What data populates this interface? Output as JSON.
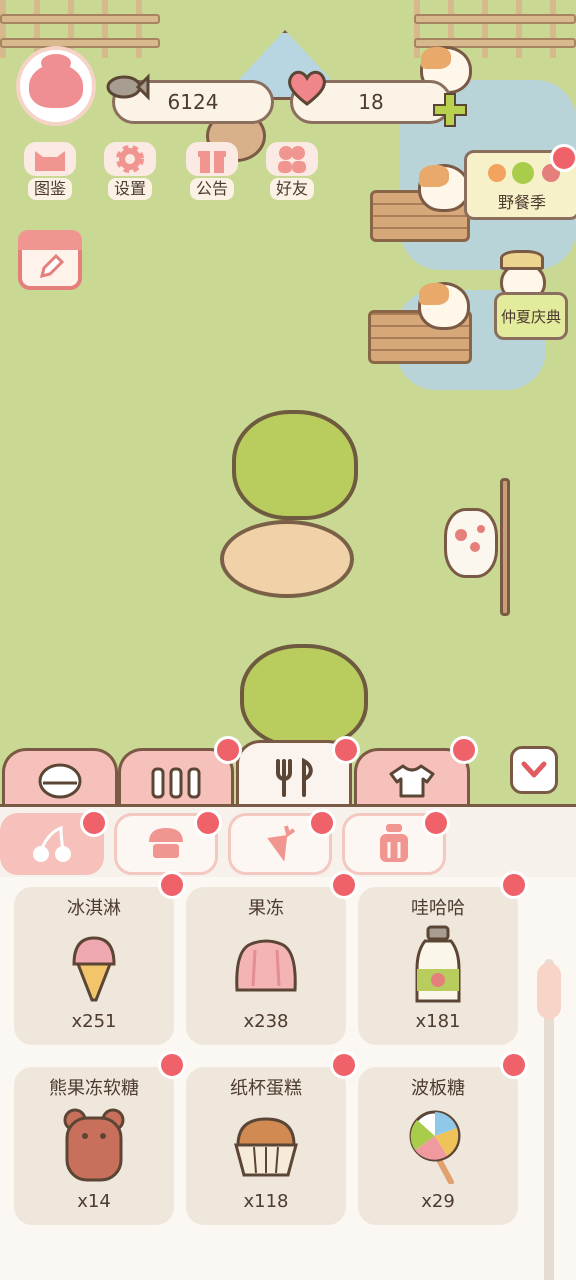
{
  "resources": {
    "fish": "6124",
    "hearts": "18"
  },
  "menu": [
    {
      "label": "图鉴",
      "icon": "cat-face-icon"
    },
    {
      "label": "设置",
      "icon": "gear-icon"
    },
    {
      "label": "公告",
      "icon": "gift-icon"
    },
    {
      "label": "好友",
      "icon": "friends-icon"
    }
  ],
  "events": {
    "picnic": "野餐季",
    "midsummer": "仲夏庆典"
  },
  "tabs": [
    {
      "icon": "bowl-icon",
      "active": false
    },
    {
      "icon": "fence-icon",
      "active": false
    },
    {
      "icon": "cutlery-icon",
      "active": true
    },
    {
      "icon": "shirt-icon",
      "active": false
    }
  ],
  "subtabs": [
    {
      "icon": "cherry-icon",
      "active": true
    },
    {
      "icon": "cupcake-icon",
      "active": false
    },
    {
      "icon": "carrot-icon",
      "active": false
    },
    {
      "icon": "jar-icon",
      "active": false
    }
  ],
  "items": [
    {
      "name": "冰淇淋",
      "qty": "x251",
      "icon": "ice-cream-icon"
    },
    {
      "name": "果冻",
      "qty": "x238",
      "icon": "jelly-icon"
    },
    {
      "name": "哇哈哈",
      "qty": "x181",
      "icon": "milk-bottle-icon"
    },
    {
      "name": "熊果冻软糖",
      "qty": "x14",
      "icon": "gummy-bear-icon"
    },
    {
      "name": "纸杯蛋糕",
      "qty": "x118",
      "icon": "cupcake-icon"
    },
    {
      "name": "波板糖",
      "qty": "x29",
      "icon": "lollipop-icon"
    }
  ]
}
